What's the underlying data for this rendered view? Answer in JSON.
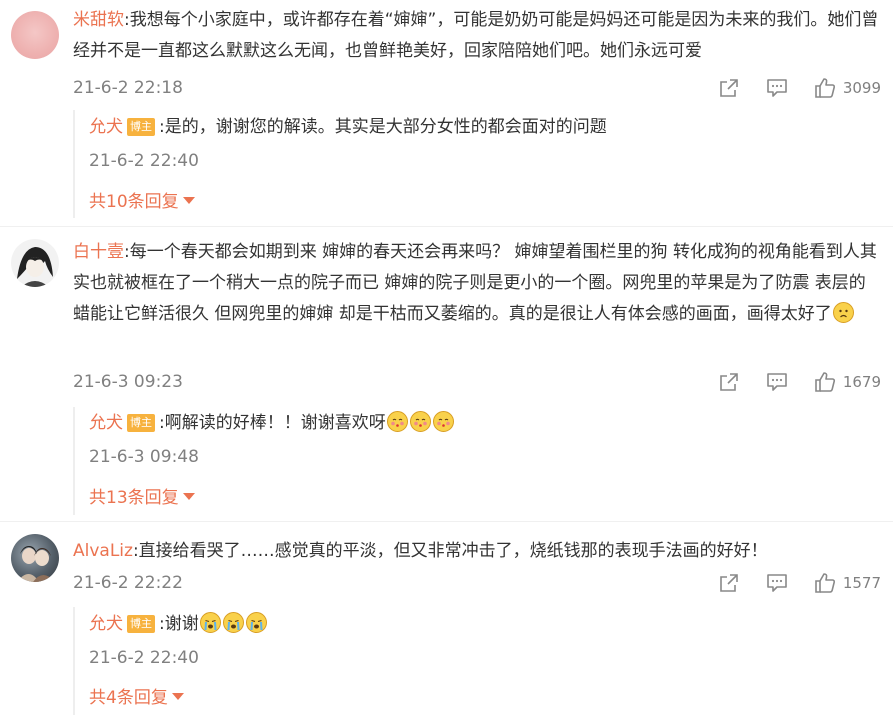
{
  "comments": [
    {
      "user": "米甜软",
      "text": ":我想每个小家庭中，或许都存在着“婶婶”，可能是奶奶可能是妈妈还可能是因为未来的我们。她们曾经并不是一直都这么默默这么无闻，也曾鲜艳美好，回家陪陪她们吧。她们永远可爱",
      "time": "21-6-2 22:18",
      "likes": "3099",
      "reply": {
        "user": "允犬",
        "badge": "博主",
        "text": ":是的，谢谢您的解读。其实是大部分女性的都会面对的问题",
        "time": "21-6-2 22:40"
      },
      "more_replies": "共10条回复"
    },
    {
      "user": "白十壹",
      "text": ":每一个春天都会如期到来 婶婶的春天还会再来吗？ 婶婶望着围栏里的狗 转化成狗的视角能看到人其实也就被框在了一个稍大一点的院子而已 婶婶的院子则是更小的一个圈。网兜里的苹果是为了防震 表层的蜡能让它鲜活很久 但网兜里的婶婶 却是干枯而又萎缩的。真的是很让人有体会感的画面，画得太好了",
      "time": "21-6-3 09:23",
      "likes": "1679",
      "reply": {
        "user": "允犬",
        "badge": "博主",
        "text": ":啊解读的好棒！！谢谢喜欢呀",
        "time": "21-6-3 09:48"
      },
      "more_replies": "共13条回复"
    },
    {
      "user": "AlvaLiz",
      "text": ":直接给看哭了……感觉真的平淡，但又非常冲击了，烧纸钱那的表现手法画的好好！",
      "time": "21-6-2 22:22",
      "likes": "1577",
      "reply": {
        "user": "允犬",
        "badge": "博主",
        "text": ":谢谢",
        "time": "21-6-2 22:40"
      },
      "more_replies": "共4条回复"
    }
  ],
  "icons": {
    "share": "share-icon",
    "comment": "comment-icon",
    "like": "like-icon",
    "caret": "caret-down-icon"
  },
  "colors": {
    "username": "#eb7350",
    "badge": "#f7b23e",
    "meta": "#808080"
  }
}
